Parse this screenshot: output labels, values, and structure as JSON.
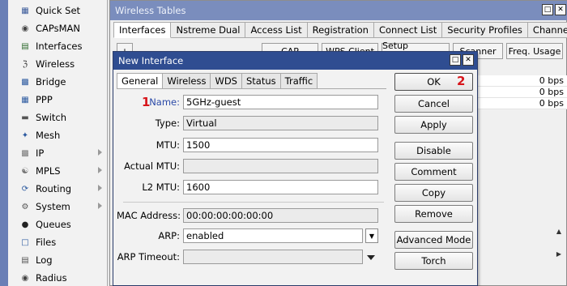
{
  "menu": {
    "items": [
      {
        "label": "Quick Set",
        "icon": "quick-set-icon",
        "submenu": false
      },
      {
        "label": "CAPsMAN",
        "icon": "capsman-icon",
        "submenu": false
      },
      {
        "label": "Interfaces",
        "icon": "interfaces-icon",
        "submenu": false
      },
      {
        "label": "Wireless",
        "icon": "wireless-icon",
        "submenu": false
      },
      {
        "label": "Bridge",
        "icon": "bridge-icon",
        "submenu": false
      },
      {
        "label": "PPP",
        "icon": "ppp-icon",
        "submenu": false
      },
      {
        "label": "Switch",
        "icon": "switch-icon",
        "submenu": false
      },
      {
        "label": "Mesh",
        "icon": "mesh-icon",
        "submenu": false
      },
      {
        "label": "IP",
        "icon": "ip-icon",
        "submenu": true
      },
      {
        "label": "MPLS",
        "icon": "mpls-icon",
        "submenu": true
      },
      {
        "label": "Routing",
        "icon": "routing-icon",
        "submenu": true
      },
      {
        "label": "System",
        "icon": "system-icon",
        "submenu": true
      },
      {
        "label": "Queues",
        "icon": "queues-icon",
        "submenu": false
      },
      {
        "label": "Files",
        "icon": "files-icon",
        "submenu": false
      },
      {
        "label": "Log",
        "icon": "log-icon",
        "submenu": false
      },
      {
        "label": "Radius",
        "icon": "radius-icon",
        "submenu": false
      }
    ]
  },
  "background_window": {
    "title": "Wireless Tables",
    "tabs": [
      "Interfaces",
      "Nstreme Dual",
      "Access List",
      "Registration",
      "Connect List",
      "Security Profiles",
      "Channels"
    ],
    "toolbar": {
      "cap": "CAP",
      "wps_client": "WPS Client",
      "setup_repeater": "Setup Repeater",
      "scanner": "Scanner",
      "freq_usage": "Freq. Usage"
    },
    "rows": [
      "0 bps",
      "0 bps",
      "0 bps"
    ]
  },
  "dialog": {
    "title": "New Interface",
    "tabs": [
      "General",
      "Wireless",
      "WDS",
      "Status",
      "Traffic"
    ],
    "fields": {
      "name": {
        "label": "Name:",
        "value": "5GHz-guest"
      },
      "type": {
        "label": "Type:",
        "value": "Virtual"
      },
      "mtu": {
        "label": "MTU:",
        "value": "1500"
      },
      "actual_mtu": {
        "label": "Actual MTU:",
        "value": ""
      },
      "l2_mtu": {
        "label": "L2 MTU:",
        "value": "1600"
      },
      "mac_address": {
        "label": "MAC Address:",
        "value": "00:00:00:00:00:00"
      },
      "arp": {
        "label": "ARP:",
        "value": "enabled"
      },
      "arp_timeout": {
        "label": "ARP Timeout:",
        "value": ""
      }
    },
    "buttons": {
      "ok": "OK",
      "cancel": "Cancel",
      "apply": "Apply",
      "disable": "Disable",
      "comment": "Comment",
      "copy": "Copy",
      "remove": "Remove",
      "advanced_mode": "Advanced Mode",
      "torch": "Torch"
    }
  },
  "annotations": {
    "step1": "1",
    "step2": "2"
  },
  "colors": {
    "menu_bar": "#6a7fb6",
    "bg_title": "#7a8dbd",
    "dialog_title": "#2f4d91",
    "name_label": "#2b4aa8",
    "marker": "#d7141a"
  }
}
